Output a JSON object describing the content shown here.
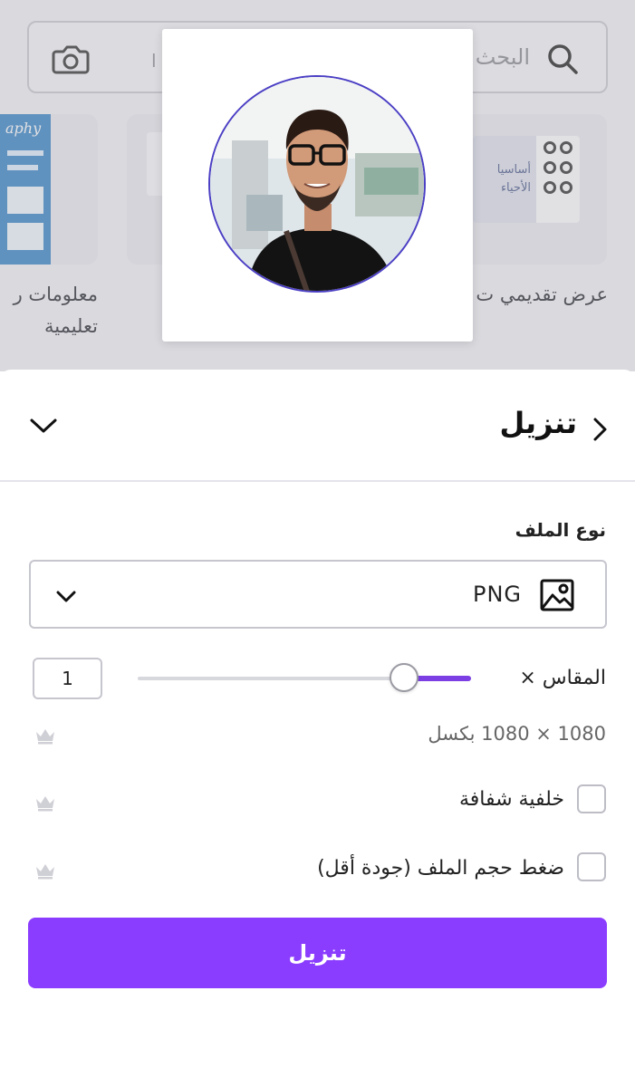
{
  "search": {
    "placeholder": "البحث",
    "placeholder_suffix": "وى ا"
  },
  "background_cards": {
    "left_label_line1": "معلومات ر",
    "left_label_line2": "تعليمية",
    "right_label": "عرض تقديمي ت",
    "right_thumb_text_1": "أساسيا",
    "right_thumb_text_2": "الأحياء",
    "left_thumb_text": "aphy"
  },
  "download_sheet": {
    "title": "تنزيل",
    "file_type_label": "نوع الملف",
    "file_type_value": "PNG",
    "scale_label": "المقاس ×",
    "scale_value": "1",
    "scale_fraction": 0.2,
    "dimensions": "1080 × 1080 بكسل",
    "options": [
      {
        "label": "خلفية شفافة",
        "checked": false,
        "premium": true
      },
      {
        "label": "ضغط حجم الملف (جودة أقل)",
        "checked": false,
        "premium": true
      }
    ],
    "download_button": "تنزيل"
  },
  "colors": {
    "accent": "#8b3dff",
    "slider_fill": "#7b3fe4",
    "avatar_ring": "#4b3fc4"
  },
  "icons": [
    "search-icon",
    "camera-icon",
    "back-chevron-icon",
    "collapse-chevron-icon",
    "image-icon",
    "chevron-down-icon",
    "crown-icon"
  ]
}
